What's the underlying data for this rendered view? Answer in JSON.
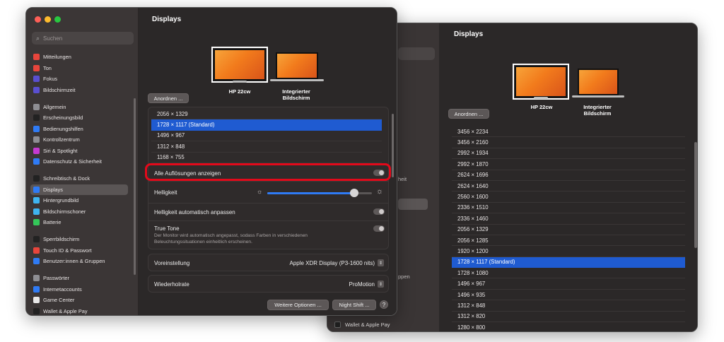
{
  "back_window": {
    "title": "Displays",
    "arrange_button": "Anordnen ...",
    "monitors": [
      {
        "label": "HP 22cw"
      },
      {
        "label": "Integrierter\nBildschirm"
      }
    ],
    "resolutions": [
      "3456 × 2234",
      "3456 × 2160",
      "2992 × 1934",
      "2992 × 1870",
      "2624 × 1696",
      "2624 × 1640",
      "2560 × 1600",
      "2336 × 1510",
      "2336 × 1460",
      "2056 × 1329",
      "2056 × 1285",
      "1920 × 1200",
      "1728 × 1117 (Standard)",
      "1728 × 1080",
      "1496 × 967",
      "1496 × 935",
      "1312 × 848",
      "1312 × 820",
      "1280 × 800"
    ],
    "selected_resolution": "1728 × 1117 (Standard)",
    "sidebar_fragments": {
      "frag1": "heit",
      "frag2": "ppen"
    },
    "sidebar_footer": "Wallet & Apple Pay"
  },
  "front_window": {
    "title": "Displays",
    "search_placeholder": "Suchen",
    "sidebar": {
      "groups": [
        [
          {
            "label": "Mitteilungen",
            "icon": "bell-icon",
            "color": "#e8453c"
          },
          {
            "label": "Ton",
            "icon": "speaker-icon",
            "color": "#e8453c"
          },
          {
            "label": "Fokus",
            "icon": "moon-icon",
            "color": "#5a4fd0"
          },
          {
            "label": "Bildschirmzeit",
            "icon": "hourglass-icon",
            "color": "#5a4fd0"
          }
        ],
        [
          {
            "label": "Allgemein",
            "icon": "gear-icon",
            "color": "#8e8e93"
          },
          {
            "label": "Erscheinungsbild",
            "icon": "appearance-icon",
            "color": "#222222"
          },
          {
            "label": "Bedienungshilfen",
            "icon": "accessibility-icon",
            "color": "#2f7bf5"
          },
          {
            "label": "Kontrollzentrum",
            "icon": "control-center-icon",
            "color": "#8e8e93"
          },
          {
            "label": "Siri & Spotlight",
            "icon": "siri-icon",
            "color": "#c53ad1"
          },
          {
            "label": "Datenschutz & Sicherheit",
            "icon": "hand-icon",
            "color": "#2f7bf5"
          }
        ],
        [
          {
            "label": "Schreibtisch & Dock",
            "icon": "dock-icon",
            "color": "#222222"
          },
          {
            "label": "Displays",
            "icon": "display-icon",
            "color": "#2f7bf5"
          },
          {
            "label": "Hintergrundbild",
            "icon": "wallpaper-icon",
            "color": "#3fb4f0"
          },
          {
            "label": "Bildschirmschoner",
            "icon": "screensaver-icon",
            "color": "#3fb4f0"
          },
          {
            "label": "Batterie",
            "icon": "battery-icon",
            "color": "#34c759"
          }
        ],
        [
          {
            "label": "Sperrbildschirm",
            "icon": "lock-screen-icon",
            "color": "#222222"
          },
          {
            "label": "Touch ID & Passwort",
            "icon": "fingerprint-icon",
            "color": "#e8453c"
          },
          {
            "label": "Benutzer:innen & Gruppen",
            "icon": "users-icon",
            "color": "#2f7bf5"
          }
        ],
        [
          {
            "label": "Passwörter",
            "icon": "key-icon",
            "color": "#8e8e93"
          },
          {
            "label": "Internetaccounts",
            "icon": "at-icon",
            "color": "#2f7bf5"
          },
          {
            "label": "Game Center",
            "icon": "game-center-icon",
            "color": "#e8e8e8"
          },
          {
            "label": "Wallet & Apple Pay",
            "icon": "wallet-icon",
            "color": "#222222"
          }
        ]
      ],
      "active": "Displays"
    },
    "arrange_button": "Anordnen ...",
    "monitors": [
      {
        "label": "HP 22cw"
      },
      {
        "label": "Integrierter\nBildschirm"
      }
    ],
    "resolutions": [
      "2056 × 1329",
      "1728 × 1117 (Standard)",
      "1496 × 967",
      "1312 × 848",
      "1168 × 755"
    ],
    "selected_resolution": "1728 × 1117 (Standard)",
    "show_all_label": "Alle Auflösungen anzeigen",
    "brightness_label": "Helligkeit",
    "brightness_level": 0.83,
    "auto_brightness_label": "Helligkeit automatisch anpassen",
    "true_tone_label": "True Tone",
    "true_tone_desc": "Der Monitor wird automatisch angepasst, sodass Farben in verschiedenen Beleuchtungssituationen einheitlich erscheinen.",
    "preset_label": "Voreinstellung",
    "preset_value": "Apple XDR Display (P3-1600 nits)",
    "refresh_label": "Wiederholrate",
    "refresh_value": "ProMotion",
    "more_options_button": "Weitere Optionen ...",
    "night_shift_button": "Night Shift ...",
    "help_button": "?"
  },
  "colors": {
    "accent": "#1f5bd1",
    "highlight": "#e3091a",
    "window_bg": "#2b2828"
  }
}
